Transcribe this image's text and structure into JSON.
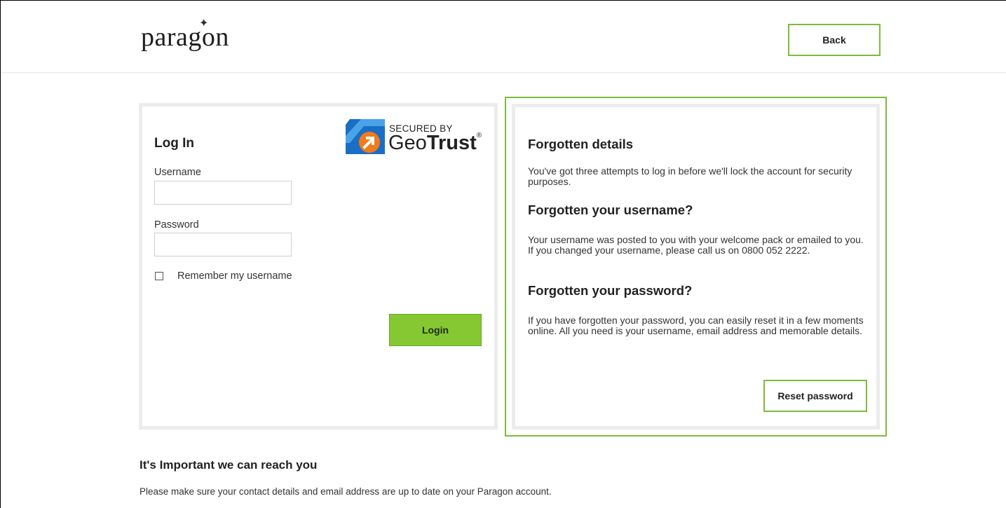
{
  "header": {
    "logo_text": "paragon",
    "back_label": "Back"
  },
  "login": {
    "title": "Log In",
    "username_label": "Username",
    "username_value": "",
    "password_label": "Password",
    "password_value": "",
    "remember_label": "Remember my username",
    "remember_checked": false,
    "login_label": "Login",
    "badge": {
      "secured_by": "SECURED BY",
      "brand_geo": "Geo",
      "brand_trust": "Trust",
      "registered": "®"
    }
  },
  "forgotten": {
    "title": "Forgotten details",
    "intro": "You've got three attempts to log in before we'll lock the account for security purposes.",
    "username_heading": "Forgotten your username?",
    "username_text": "Your username was posted to you with your welcome pack or emailed to you. If you changed your username, please call us on 0800 052 2222.",
    "password_heading": "Forgotten your password?",
    "password_text": "If you have forgotten your password, you can easily reset it in a few moments online. All you need is your username, email address and memorable details.",
    "reset_label": "Reset password"
  },
  "contact": {
    "title": "It's Important we can reach you",
    "text": "Please make sure your contact details and email address are up to date on your Paragon account."
  },
  "colors": {
    "accent_green": "#7bbd3a",
    "login_button": "#86c832",
    "panel_border": "#ececec",
    "geotrust_blue": "#1a6fc4",
    "geotrust_orange": "#f27a1a"
  }
}
